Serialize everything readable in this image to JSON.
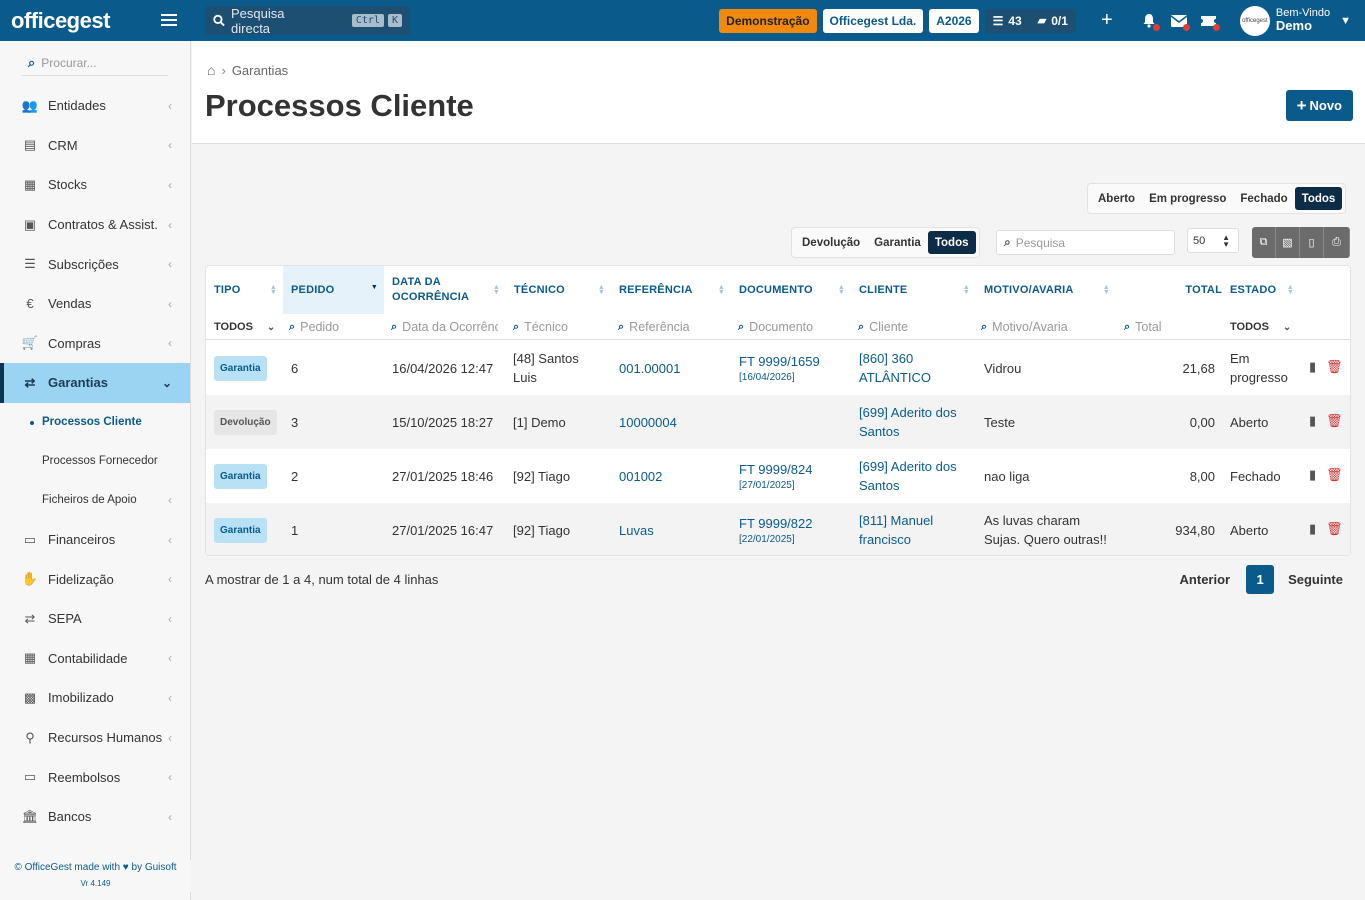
{
  "app": {
    "logo": "officegest",
    "search_label": "Pesquisa directa",
    "search_kbd_1": "Ctrl",
    "search_kbd_2": "K"
  },
  "topbar": {
    "demo": "Demonstração",
    "company": "Officegest Lda.",
    "year": "A2026",
    "tasks_count": "43",
    "docs_count": "0/1",
    "welcome": "Bem-Vindo",
    "user": "Demo"
  },
  "sidebar": {
    "search_placeholder": "Procurar...",
    "items": [
      {
        "label": "Entidades",
        "icon": "users-icon"
      },
      {
        "label": "CRM",
        "icon": "address-book-icon"
      },
      {
        "label": "Stocks",
        "icon": "warehouse-icon"
      },
      {
        "label": "Contratos & Assist.",
        "icon": "contract-icon"
      },
      {
        "label": "Subscrições",
        "icon": "list-icon"
      },
      {
        "label": "Vendas",
        "icon": "euro-icon"
      },
      {
        "label": "Compras",
        "icon": "cart-icon"
      },
      {
        "label": "Garantias",
        "icon": "exchange-icon"
      }
    ],
    "subitems": [
      {
        "label": "Processos Cliente"
      },
      {
        "label": "Processos Fornecedor"
      },
      {
        "label": "Ficheiros de Apoio"
      }
    ],
    "items2": [
      {
        "label": "Financeiros",
        "icon": "money-icon"
      },
      {
        "label": "Fidelização",
        "icon": "hand-icon"
      },
      {
        "label": "SEPA",
        "icon": "exchange-icon"
      },
      {
        "label": "Contabilidade",
        "icon": "calculator-icon"
      },
      {
        "label": "Imobilizado",
        "icon": "box-icon"
      },
      {
        "label": "Recursos Humanos",
        "icon": "sitemap-icon"
      },
      {
        "label": "Reembolsos",
        "icon": "money-icon"
      },
      {
        "label": "Bancos",
        "icon": "bank-icon"
      }
    ],
    "footer": "© OfficeGest made with ♥ by Guisoft",
    "version": "Vr 4.149"
  },
  "page": {
    "breadcrumb": "Garantias",
    "title": "Processos Cliente",
    "new_button": "Novo"
  },
  "filters": {
    "estado": [
      "Aberto",
      "Em progresso",
      "Fechado",
      "Todos"
    ],
    "estado_selected": "Todos",
    "tipo": [
      "Devolução",
      "Garantia",
      "Todos"
    ],
    "tipo_selected": "Todos",
    "search_placeholder": "Pesquisa",
    "page_size": "50"
  },
  "table": {
    "headers": {
      "tipo": "TIPO",
      "pedido": "PEDIDO",
      "data1": "DATA DA",
      "data2": "OCORRÊNCIA",
      "tecnico": "TÉCNICO",
      "referencia": "REFERÊNCIA",
      "documento": "DOCUMENTO",
      "cliente": "CLIENTE",
      "motivo": "MOTIVO/AVARIA",
      "total": "TOTAL",
      "estado": "ESTADO"
    },
    "filters": {
      "tipo": "TODOS",
      "pedido": "Pedido",
      "data": "Data da Ocorrênc",
      "tecnico": "Técnico",
      "referencia": "Referência",
      "documento": "Documento",
      "cliente": "Cliente",
      "motivo": "Motivo/Avaria",
      "total": "Total",
      "estado": "TODOS"
    },
    "rows": [
      {
        "tipo": "Garantia",
        "pedido": "6",
        "data": "16/04/2026 12:47",
        "tecnico": "[48] Santos Luis",
        "referencia": "001.00001",
        "doc": "FT 9999/1659",
        "doc_date": "[16/04/2026]",
        "cliente": "[860] 360 ATLÂNTICO",
        "motivo": "Vidrou",
        "total": "21,68",
        "estado": "Em progresso"
      },
      {
        "tipo": "Devolução",
        "pedido": "3",
        "data": "15/10/2025 18:27",
        "tecnico": "[1] Demo",
        "referencia": "10000004",
        "doc": "",
        "doc_date": "",
        "cliente": "[699] Aderito dos Santos",
        "motivo": "Teste",
        "total": "0,00",
        "estado": "Aberto"
      },
      {
        "tipo": "Garantia",
        "pedido": "2",
        "data": "27/01/2025 18:46",
        "tecnico": "[92] Tiago",
        "referencia": "001002",
        "doc": "FT 9999/824",
        "doc_date": "[27/01/2025]",
        "cliente": "[699] Aderito dos Santos",
        "motivo": "nao liga",
        "total": "8,00",
        "estado": "Fechado"
      },
      {
        "tipo": "Garantia",
        "pedido": "1",
        "data": "27/01/2025 16:47",
        "tecnico": "[92] Tiago",
        "referencia": "Luvas",
        "doc": "FT 9999/822",
        "doc_date": "[22/01/2025]",
        "cliente": "[811] Manuel francisco",
        "motivo": "As luvas charam Sujas. Quero outras!!",
        "total": "934,80",
        "estado": "Aberto"
      }
    ]
  },
  "footer": {
    "info": "A mostrar de 1 a 4, num total de 4 linhas",
    "prev": "Anterior",
    "page": "1",
    "next": "Seguinte"
  }
}
